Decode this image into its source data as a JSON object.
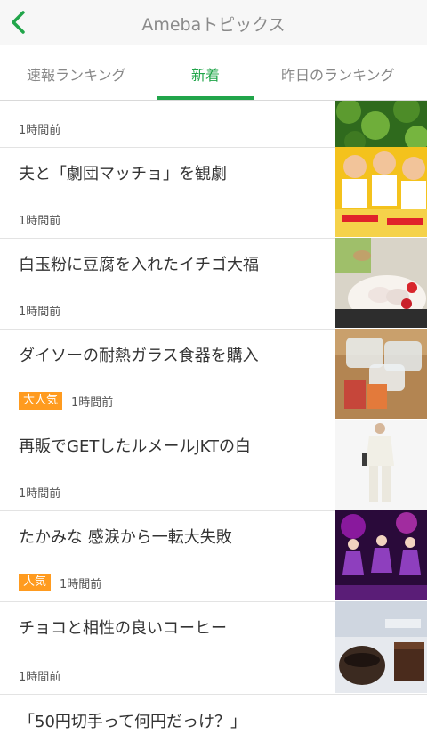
{
  "header": {
    "title": "Amebaトピックス"
  },
  "tabs": [
    {
      "label": "速報ランキング"
    },
    {
      "label": "新着"
    },
    {
      "label": "昨日のランキング"
    }
  ],
  "accent_color": "#21a54a",
  "items": [
    {
      "title": "",
      "time": "1時間前",
      "badge": "",
      "thumb": "leaves"
    },
    {
      "title": "夫と「劇団マッチョ」を観劇",
      "time": "1時間前",
      "badge": "",
      "thumb": "cartoon-muscle-men"
    },
    {
      "title": "白玉粉に豆腐を入れたイチゴ大福",
      "time": "1時間前",
      "badge": "",
      "thumb": "daifuku-plate"
    },
    {
      "title": "ダイソーの耐熱ガラス食器を購入",
      "time": "1時間前",
      "badge": "大人気",
      "thumb": "glass-dishes"
    },
    {
      "title": "再販でGETしたルメールJKTの白",
      "time": "1時間前",
      "badge": "",
      "thumb": "white-jacket"
    },
    {
      "title": "たかみな 感涙から一転大失敗",
      "time": "1時間前",
      "badge": "人気",
      "thumb": "stage-performance"
    },
    {
      "title": "チョコと相性の良いコーヒー",
      "time": "1時間前",
      "badge": "",
      "thumb": "coffee-chocolate"
    }
  ],
  "last_item": {
    "title": "「50円切手って何円だっけ？」"
  }
}
